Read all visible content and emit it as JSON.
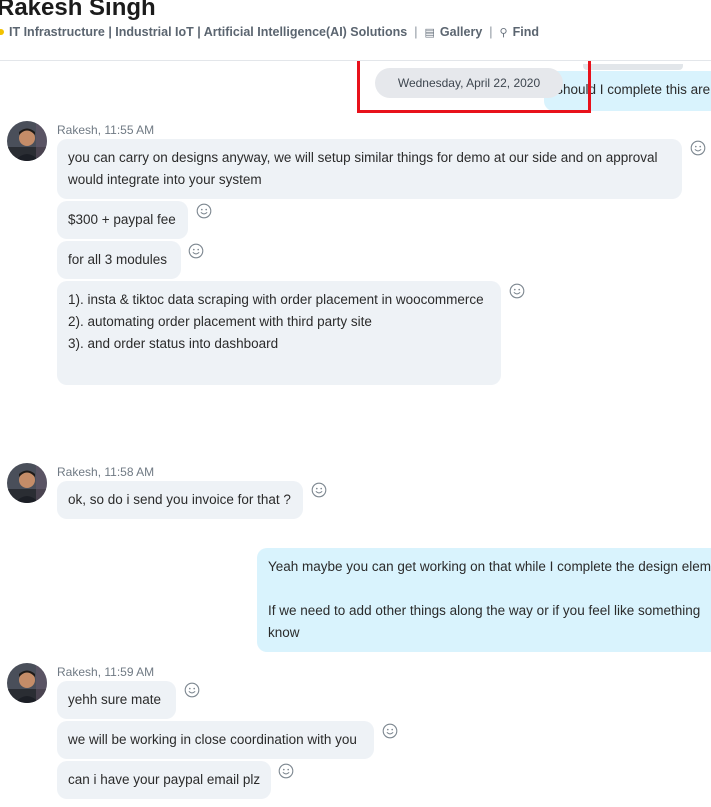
{
  "header": {
    "contact_name": "Rakesh Singh",
    "status_color": "#f2c200",
    "mood_text": "IT Infrastructure | Industrial IoT | Artificial Intelligence(AI) Solutions",
    "gallery_label": "Gallery",
    "find_label": "Find",
    "gallery_icon": "gallery-icon",
    "find_icon": "search-icon"
  },
  "date_divider": "Wednesday, April 22, 2020",
  "outgoing_top": "Should I complete this are",
  "groups": [
    {
      "sender": "Rakesh, 11:55 AM",
      "messages": [
        {
          "lines": [
            "you can carry on designs anyway, we will setup similar things for demo at our side and on approval",
            "would integrate into your system"
          ]
        },
        {
          "lines": [
            "$300 + paypal fee"
          ]
        },
        {
          "lines": [
            "for all 3 modules"
          ]
        },
        {
          "lines": [
            "1). insta & tiktoc data scraping with order placement in woocommerce",
            "2). automating order placement with third party site",
            "3). and order status into dashboard"
          ]
        }
      ]
    },
    {
      "sender": "Rakesh, 11:58 AM",
      "messages": [
        {
          "lines": [
            "ok, so do i send you invoice for that ?"
          ]
        }
      ]
    },
    {
      "sender": "Rakesh, 11:59 AM",
      "messages": [
        {
          "lines": [
            "yehh  sure mate"
          ]
        },
        {
          "lines": [
            "we will be working in close coordination with you"
          ]
        },
        {
          "lines": [
            "can i have your paypal email plz"
          ]
        }
      ]
    }
  ],
  "outgoing_reply": {
    "lines": [
      "Yeah maybe you can get working on that while I complete the design elem",
      "",
      "If we need to add other things along the way or if you feel like something",
      "know"
    ]
  },
  "colors": {
    "incoming_bubble": "#eef2f6",
    "outgoing_bubble": "#d9f3fd",
    "highlight_box": "#e8111b"
  }
}
